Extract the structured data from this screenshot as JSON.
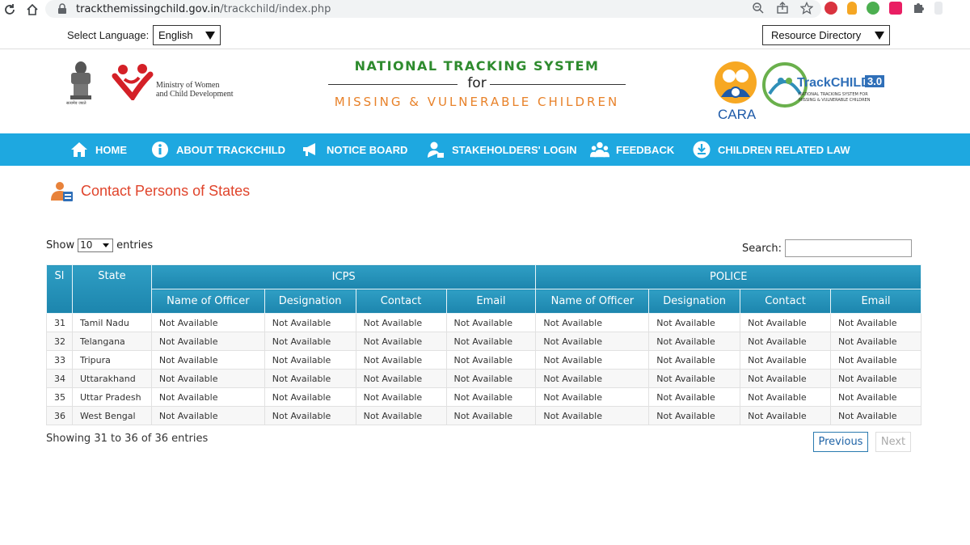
{
  "browser": {
    "url_host": "trackthemissingchild.gov.in",
    "url_path": "/trackchild/index.php"
  },
  "langbar": {
    "label": "Select Language:",
    "language": "English",
    "resource": "Resource Directory"
  },
  "header": {
    "mwcd_line1": "Ministry of Women",
    "mwcd_line2": "and Child Development",
    "emblem_text": "सत्यमेव जयते",
    "title1": "NATIONAL TRACKING SYSTEM",
    "title_for": "for",
    "title2": "MISSING & VULNERABLE CHILDREN",
    "cara": "CARA",
    "trackchild": "TrackCHILD",
    "trackchild_version": "3.0",
    "trackchild_sub1": "NATIONAL TRACKING SYSTEM FOR",
    "trackchild_sub2": "MISSING & VULNERABLE CHILDREN"
  },
  "menu": {
    "home": "HOME",
    "about": "ABOUT TRACKCHILD",
    "notice": "NOTICE BOARD",
    "login": "STAKEHOLDERS' LOGIN",
    "feedback": "FEEDBACK",
    "law": "CHILDREN RELATED LAW"
  },
  "page": {
    "heading": "Contact Persons of States"
  },
  "controls": {
    "show": "Show",
    "length": "10",
    "entries": "entries",
    "search": "Search:"
  },
  "table": {
    "head_sl": "Sl",
    "head_state": "State",
    "head_icps": "ICPS",
    "head_police": "POLICE",
    "sub": [
      "Name of Officer",
      "Designation",
      "Contact",
      "Email",
      "Name of Officer",
      "Designation",
      "Contact",
      "Email"
    ],
    "rows": [
      {
        "sl": "31",
        "state": "Tamil Nadu",
        "c1": "Not Available",
        "c2": "Not Available",
        "c3": "Not Available",
        "c4": "Not Available",
        "c5": "Not Available",
        "c6": "Not Available",
        "c7": "Not Available",
        "c8": "Not Available"
      },
      {
        "sl": "32",
        "state": "Telangana",
        "c1": "Not Available",
        "c2": "Not Available",
        "c3": "Not Available",
        "c4": "Not Available",
        "c5": "Not Available",
        "c6": "Not Available",
        "c7": "Not Available",
        "c8": "Not Available"
      },
      {
        "sl": "33",
        "state": "Tripura",
        "c1": "Not Available",
        "c2": "Not Available",
        "c3": "Not Available",
        "c4": "Not Available",
        "c5": "Not Available",
        "c6": "Not Available",
        "c7": "Not Available",
        "c8": "Not Available"
      },
      {
        "sl": "34",
        "state": "Uttarakhand",
        "c1": "Not Available",
        "c2": "Not Available",
        "c3": "Not Available",
        "c4": "Not Available",
        "c5": "Not Available",
        "c6": "Not Available",
        "c7": "Not Available",
        "c8": "Not Available"
      },
      {
        "sl": "35",
        "state": "Uttar Pradesh",
        "c1": "Not Available",
        "c2": "Not Available",
        "c3": "Not Available",
        "c4": "Not Available",
        "c5": "Not Available",
        "c6": "Not Available",
        "c7": "Not Available",
        "c8": "Not Available"
      },
      {
        "sl": "36",
        "state": "West Bengal",
        "c1": "Not Available",
        "c2": "Not Available",
        "c3": "Not Available",
        "c4": "Not Available",
        "c5": "Not Available",
        "c6": "Not Available",
        "c7": "Not Available",
        "c8": "Not Available"
      }
    ]
  },
  "footer": {
    "info": "Showing 31 to 36 of 36 entries",
    "previous": "Previous",
    "next": "Next"
  },
  "colors": {
    "menu_bg": "#1ea8e0",
    "heading": "#e0442b",
    "title_green": "#2e8b2e",
    "title_orange": "#e8822a"
  }
}
